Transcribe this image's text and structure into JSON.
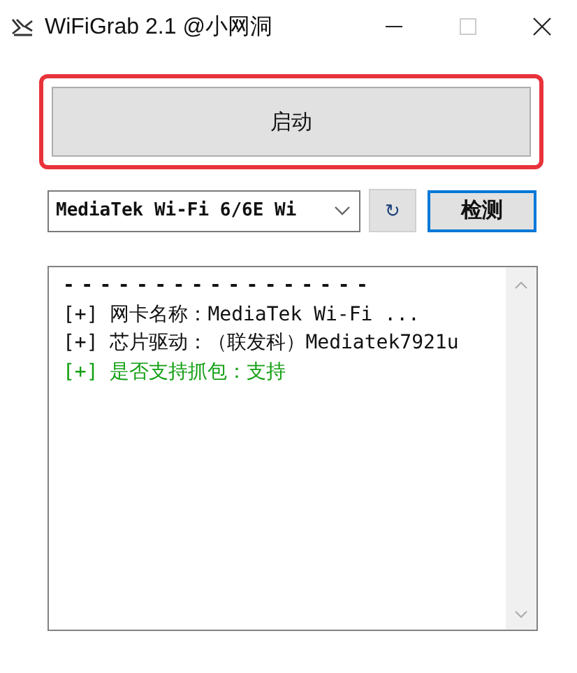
{
  "window": {
    "title": "WiFiGrab 2.1 @小网洞",
    "maximize_disabled": true
  },
  "start_button": {
    "label": "启动",
    "highlighted": true
  },
  "adapter_select": {
    "value": "MediaTek Wi-Fi 6/6E Wi"
  },
  "refresh_button": {
    "label": "↻"
  },
  "detect_button": {
    "label": "检测",
    "focused": true
  },
  "log": [
    {
      "kind": "separator",
      "text": "-----------------"
    },
    {
      "kind": "info",
      "text": "[+] 网卡名称：MediaTek Wi-Fi ..."
    },
    {
      "kind": "info",
      "text": "[+] 芯片驱动：（联发科）Mediatek7921u"
    },
    {
      "kind": "success",
      "text": "[+] 是否支持抓包：支持"
    }
  ]
}
